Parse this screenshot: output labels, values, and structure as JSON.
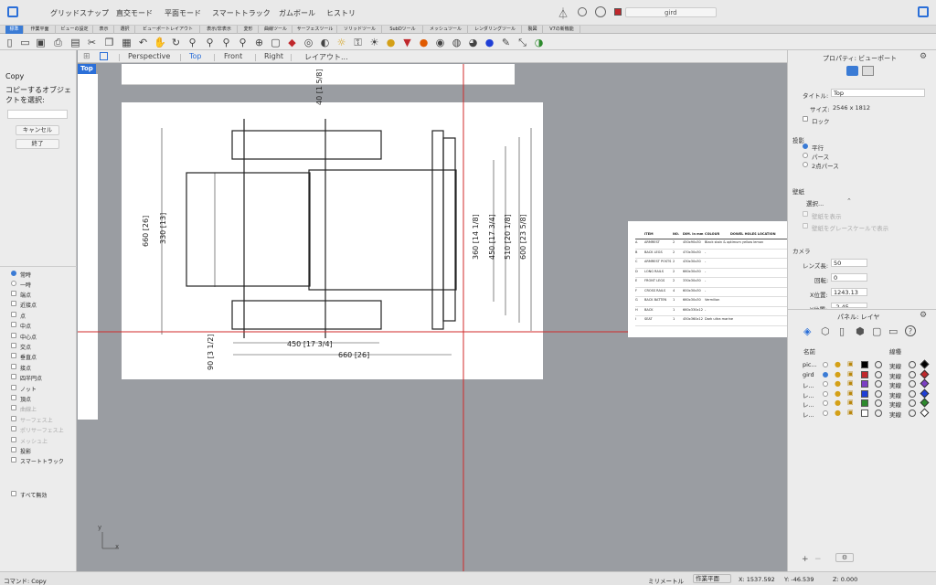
{
  "title_bar": {
    "modes": [
      "グリッドスナップ",
      "直交モード",
      "平面モード",
      "スマートトラック",
      "ガムボール",
      "ヒストリ"
    ],
    "layer_name": "gird",
    "layer_color": "#c0282c"
  },
  "tabs": [
    "標準",
    "作業平面",
    "ビューの設定",
    "表示",
    "選択",
    "ビューポートレイアウト",
    "表示/非表示",
    "変形",
    "曲線ツール",
    "サーフェスツール",
    "ソリッドツール",
    "SubDツール",
    "メッシュツール",
    "レンダリングツール",
    "製図",
    "V7の新機能"
  ],
  "toolbar_icons": [
    "new-file-icon",
    "open-file-icon",
    "save-icon",
    "print-icon",
    "save-as-icon",
    "cut-icon",
    "copy-icon",
    "paste-icon",
    "undo-icon",
    "pan-icon",
    "rotate-view-icon",
    "zoom-icon",
    "zoom-window-icon",
    "zoom-extents-icon",
    "zoom-selected-icon",
    "set-view-icon",
    "box-icon",
    "car-icon",
    "select-icon",
    "hide-icon",
    "show-icon",
    "lock-icon",
    "light-icon",
    "lamp-icon",
    "paint-icon",
    "color-wheel-icon",
    "render-sphere-icon",
    "material-icon",
    "rendered-icon",
    "blue-sphere-icon",
    "pen-icon",
    "transform-icon",
    "globe-icon"
  ],
  "view_tabs": {
    "perspective": "Perspective",
    "top": "Top",
    "front": "Front",
    "right": "Right",
    "layout": "レイアウト..."
  },
  "viewport_label": "Top",
  "left_panel": {
    "title": "Copy",
    "prompt": "コピーするオブジェクトを選択:",
    "cancel": "キャンセル",
    "finish": "終了",
    "snaps": [
      "端点",
      "近接点",
      "点",
      "中点",
      "中心点",
      "交点",
      "垂直点",
      "接点",
      "四半円点",
      "ノット",
      "頂点",
      "曲線上",
      "サーフェス上",
      "ポリサーフェス上",
      "メッシュ上",
      "投影",
      "スマートトラック"
    ],
    "snap_modes": [
      "常時",
      "一時"
    ],
    "disable_all": "すべて無効"
  },
  "drawing": {
    "dims": [
      "40 [1 5/8]",
      "660 [26]",
      "330 [13]",
      "360 [14 1/8]",
      "450 [17 3/4]",
      "510 [20 1/8]",
      "600 [23 5/8]",
      "450 [17 3/4]",
      "660 [26]",
      "90 [3 1/2]",
      "40 [1"
    ],
    "table_headers": [
      "ITEM",
      "NO.",
      "DIM. in mm",
      "COLOUR",
      "DOWEL HOLES LOCATION"
    ],
    "table_rows": [
      [
        "A",
        "ARMREST",
        "2",
        "450x90x30",
        "Black stain & optimum yellow lemon"
      ],
      [
        "B",
        "BACK LEGS",
        "2",
        "470x30x30",
        "-"
      ],
      [
        "C",
        "ARMREST POSTS",
        "2",
        "430x30x30",
        "-"
      ],
      [
        "D",
        "LONG RAILS",
        "2",
        "660x30x30",
        "-"
      ],
      [
        "E",
        "FRONT LEGS",
        "2",
        "330x30x30",
        "-"
      ],
      [
        "F",
        "CROSS RAILS",
        "4",
        "600x30x30",
        "-"
      ],
      [
        "G",
        "BACK BATTEN",
        "1",
        "660x30x30",
        "Vermilion"
      ],
      [
        "H",
        "BACK",
        "1",
        "660x330x12",
        "-"
      ],
      [
        "I",
        "SEAT",
        "1",
        "450x360x12",
        "Dark ultra marine"
      ]
    ]
  },
  "properties": {
    "header": "プロパティ: ビューポート",
    "title_label": "タイトル:",
    "title_value": "Top",
    "size_label": "サイズ:",
    "size_value": "2546 x 1812",
    "lock": "ロック",
    "projection_label": "投影",
    "projections": [
      "平行",
      "パース",
      "2点パース"
    ],
    "wallpaper_label": "壁紙",
    "wallpaper_select": "選択...",
    "wallpaper_show": "壁紙を表示",
    "wallpaper_gray": "壁紙をグレースケールで表示",
    "camera_label": "カメラ",
    "lens_label": "レンズ長:",
    "lens_value": "50",
    "rotation_label": "回転:",
    "rotation_value": "0",
    "xpos_label": "X位置:",
    "xpos_value": "1243.13",
    "ypos_label": "Y位置:",
    "ypos_value": "-2.45"
  },
  "layers": {
    "header": "パネル: レイヤ",
    "col_name": "名前",
    "col_linetype": "線種",
    "rows": [
      {
        "name": "pic...",
        "linetype": "実線",
        "color": "#000000"
      },
      {
        "name": "gird",
        "linetype": "実線",
        "color": "#c0282c"
      },
      {
        "name": "レ...",
        "linetype": "実線",
        "color": "#7b3fc4"
      },
      {
        "name": "レ...",
        "linetype": "実線",
        "color": "#1f3fd6"
      },
      {
        "name": "レ...",
        "linetype": "実線",
        "color": "#2d8a2d"
      },
      {
        "name": "レ...",
        "linetype": "実線",
        "color": "#ffffff"
      }
    ]
  },
  "status": {
    "command": "コマンド: Copy",
    "unit": "ミリメートル",
    "cplane": "作業平面",
    "x": "X: 1537.592",
    "y": "Y: -46.539",
    "z": "Z: 0.000"
  },
  "axis": {
    "x": "x",
    "y": "y"
  }
}
